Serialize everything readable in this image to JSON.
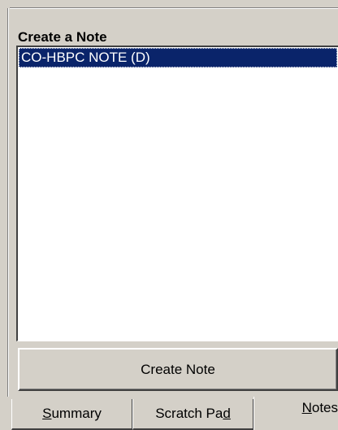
{
  "panel": {
    "header": "Create a Note",
    "list_items": [
      {
        "label": "CO-HBPC NOTE (D)",
        "selected": true
      }
    ],
    "create_button_label": "Create Note"
  },
  "tabs": [
    {
      "label_pre": "",
      "label_acc": "S",
      "label_post": "ummary",
      "active": false
    },
    {
      "label_pre": "Scratch Pa",
      "label_acc": "d",
      "label_post": "",
      "active": false
    },
    {
      "label_pre": "",
      "label_acc": "N",
      "label_post": "otes",
      "active": true
    }
  ],
  "colors": {
    "face": "#d4d0c8",
    "selection": "#0a246a",
    "list_bg": "#ffffff"
  }
}
